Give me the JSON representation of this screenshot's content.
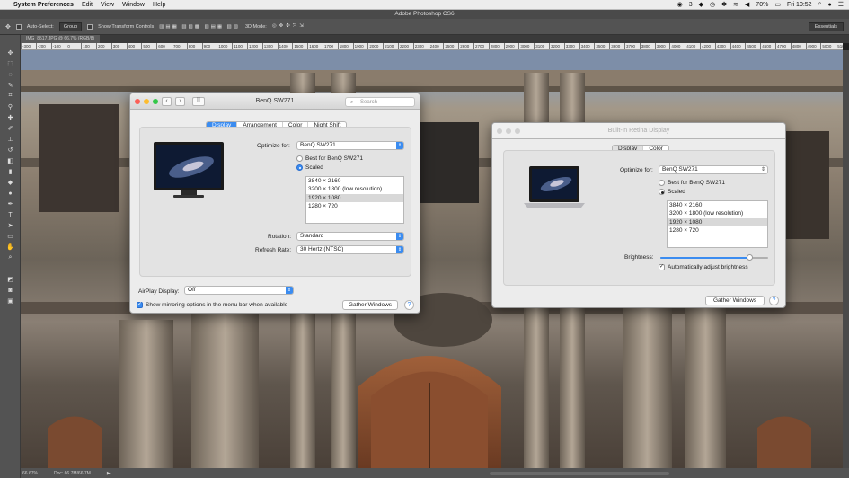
{
  "menubar": {
    "app": "System Preferences",
    "items": [
      "Edit",
      "View",
      "Window",
      "Help"
    ],
    "status_num": "3",
    "battery": "70%",
    "clock": "Fri 10:52"
  },
  "photoshop": {
    "title": "Adobe Photoshop CS6",
    "options": {
      "auto_select": "Auto-Select:",
      "group": "Group",
      "show_transform": "Show Transform Controls",
      "mode3d": "3D Mode:",
      "workspace": "Essentials"
    },
    "doc_tab": "IMG_8517.JPG @ 66.7% (RGB/8)",
    "ruler_ticks": [
      "-300",
      "-200",
      "-100",
      "0",
      "100",
      "200",
      "300",
      "400",
      "500",
      "600",
      "700",
      "800",
      "900",
      "1000",
      "1100",
      "1200",
      "1300",
      "1400",
      "1500",
      "1600",
      "1700",
      "1800",
      "1900",
      "2000",
      "2100",
      "2200",
      "2300",
      "2400",
      "2500",
      "2600",
      "2700",
      "2800",
      "2900",
      "3000",
      "3100",
      "3200",
      "3300",
      "3400",
      "3500",
      "3600",
      "3700",
      "3800",
      "3900",
      "4000",
      "4100",
      "4200",
      "4300",
      "4400",
      "4500",
      "4600",
      "4700",
      "4800",
      "4900",
      "5000",
      "5100"
    ],
    "status": {
      "zoom": "66.67%",
      "doc": "Doc: 66.7M/66.7M"
    }
  },
  "win1": {
    "title": "BenQ SW271",
    "search_placeholder": "Search",
    "tabs": [
      "Display",
      "Arrangement",
      "Color",
      "Night Shift"
    ],
    "optimize_label": "Optimize for:",
    "optimize_value": "BenQ SW271",
    "radio_best": "Best for BenQ SW271",
    "radio_scaled": "Scaled",
    "resolutions": [
      "3840 × 2160",
      "3200 × 1800 (low resolution)",
      "1920 × 1080",
      "1280 × 720"
    ],
    "selected_resolution": "1920 × 1080",
    "rotation_label": "Rotation:",
    "rotation_value": "Standard",
    "refresh_label": "Refresh Rate:",
    "refresh_value": "30 Hertz (NTSC)",
    "airplay_label": "AirPlay Display:",
    "airplay_value": "Off",
    "mirroring_label": "Show mirroring options in the menu bar when available",
    "mirroring_checked": true,
    "gather_label": "Gather Windows",
    "help_label": "?"
  },
  "win2": {
    "title": "Built-in Retina Display",
    "tabs": [
      "Display",
      "Color"
    ],
    "optimize_label": "Optimize for:",
    "optimize_value": "BenQ SW271",
    "radio_best": "Best for BenQ SW271",
    "radio_scaled": "Scaled",
    "resolutions": [
      "3840 × 2160",
      "3200 × 1800 (low resolution)",
      "1920 × 1080",
      "1280 × 720"
    ],
    "selected_resolution": "1920 × 1080",
    "brightness_label": "Brightness:",
    "brightness_level": 0.83,
    "auto_brightness_label": "Automatically adjust brightness",
    "auto_brightness_checked": true,
    "gather_label": "Gather Windows",
    "help_label": "?"
  },
  "colors": {
    "accent": "#3b8cf0",
    "close": "#fc5f57",
    "minimize": "#fdbc2e",
    "zoom": "#33c748",
    "ps_panel": "#535353"
  }
}
